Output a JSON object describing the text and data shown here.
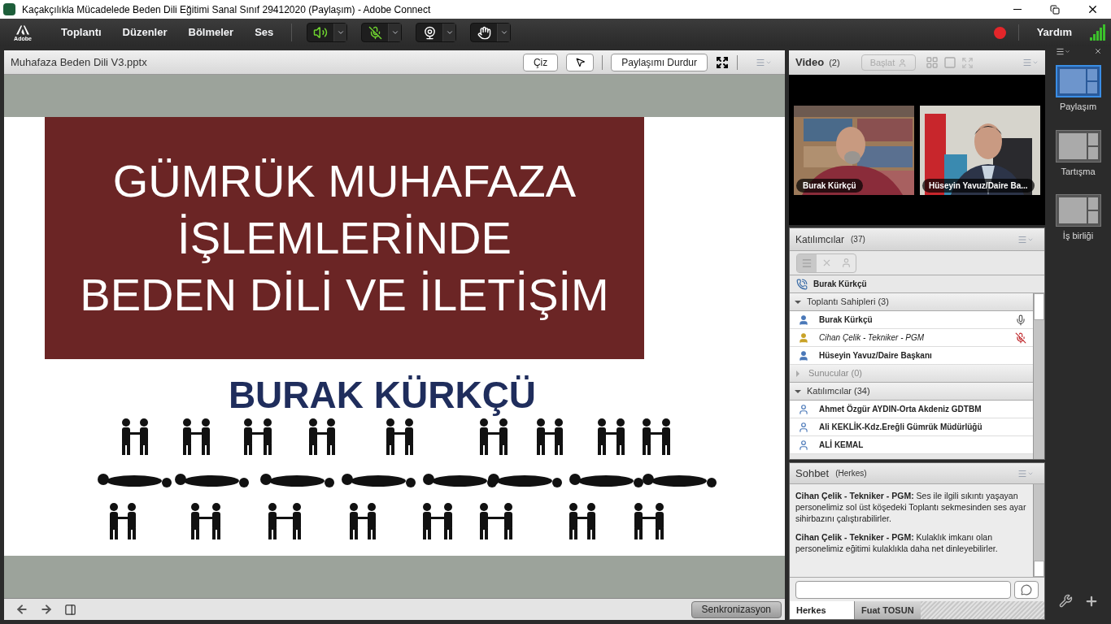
{
  "window": {
    "title": "Kaçakçılıkla Mücadelede Beden Dili Eğitimi Sanal Sınıf 29412020 (Paylaşım) - Adobe Connect"
  },
  "menu_bar": {
    "logo": "Adobe",
    "items": [
      "Toplantı",
      "Düzenler",
      "Bölmeler",
      "Ses"
    ],
    "recording": true,
    "help": "Yardım"
  },
  "share_pod": {
    "title": "Muhafaza Beden Dili V3.pptx",
    "draw_button": "Çiz",
    "stop_button": "Paylaşımı Durdur",
    "slide": {
      "title_lines": [
        "GÜMRÜK MUHAFAZA",
        "İŞLEMLERİNDE",
        "BEDEN DİLİ VE İLETİŞİM"
      ],
      "presenter": "BURAK KÜRKÇÜ"
    },
    "sync_button": "Senkronizasyon"
  },
  "video_pod": {
    "title": "Video",
    "count": "(2)",
    "start_button": "Başlat",
    "feeds": [
      {
        "name": "Burak Kürkçü"
      },
      {
        "name": "Hüseyin Yavuz/Daire Ba..."
      }
    ]
  },
  "participants_pod": {
    "title": "Katılımcılar",
    "count": "(37)",
    "active_speaker": "Burak Kürkçü",
    "groups": [
      {
        "label": "Toplantı Sahipleri (3)",
        "expanded": true,
        "people": [
          {
            "name": "Burak Kürkçü",
            "current_user": false,
            "speaking": true,
            "mic_muted": false
          },
          {
            "name": "Cihan Çelik - Tekniker - PGM",
            "current_user": true,
            "speaking": false,
            "mic_muted": true
          },
          {
            "name": "Hüseyin Yavuz/Daire Başkanı",
            "current_user": false,
            "speaking": false,
            "mic_muted": false
          }
        ]
      },
      {
        "label": "Sunucular (0)",
        "expanded": false
      },
      {
        "label": "Katılımcılar (34)",
        "expanded": true,
        "people": [
          {
            "name": "Ahmet Özgür AYDIN-Orta Akdeniz GDTBM",
            "current_user": false,
            "speaking": false,
            "mic_muted": false
          },
          {
            "name": "Ali KEKLİK-Kdz.Ereğli Gümrük Müdürlüğü",
            "current_user": false,
            "speaking": false,
            "mic_muted": false
          },
          {
            "name": "ALİ KEMAL",
            "current_user": false,
            "speaking": false,
            "mic_muted": false
          }
        ]
      }
    ]
  },
  "chat_pod": {
    "title": "Sohbet",
    "scope": "(Herkes)",
    "messages": [
      {
        "sender": "Cihan Çelik - Tekniker - PGM:",
        "text": "Ses ile ilgili sıkıntı yaşayan personelimiz sol üst köşedeki Toplantı sekmesinden ses ayar sihirbazını çalıştırabilirler."
      },
      {
        "sender": "Cihan Çelik - Tekniker - PGM:",
        "text": "Kulaklık imkanı olan personelimiz eğitimi kulaklıkla daha net dinleyebilirler."
      }
    ],
    "tabs": [
      {
        "label": "Herkes",
        "selected": true
      },
      {
        "label": "Fuat TOSUN",
        "selected": false
      }
    ]
  },
  "layouts": [
    {
      "label": "Paylaşım",
      "selected": true
    },
    {
      "label": "Tartışma",
      "selected": false
    },
    {
      "label": "İş birliği",
      "selected": false
    }
  ]
}
